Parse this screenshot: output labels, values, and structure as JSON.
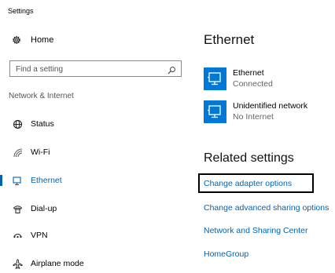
{
  "window": {
    "title": "Settings"
  },
  "sidebar": {
    "home": {
      "label": "Home",
      "icon": "gear-icon"
    },
    "search": {
      "placeholder": "Find a setting",
      "icon": "search-icon"
    },
    "section_title": "Network & Internet",
    "items": [
      {
        "label": "Status",
        "icon": "globe-icon",
        "active": false
      },
      {
        "label": "Wi-Fi",
        "icon": "wifi-icon",
        "active": false
      },
      {
        "label": "Ethernet",
        "icon": "ethernet-icon",
        "active": true
      },
      {
        "label": "Dial-up",
        "icon": "dialup-icon",
        "active": false
      },
      {
        "label": "VPN",
        "icon": "vpn-icon",
        "active": false
      },
      {
        "label": "Airplane mode",
        "icon": "airplane-icon",
        "active": false
      }
    ]
  },
  "main": {
    "title": "Ethernet",
    "networks": [
      {
        "name": "Ethernet",
        "status": "Connected",
        "icon": "monitor-network-icon"
      },
      {
        "name": "Unidentified network",
        "status": "No Internet",
        "icon": "monitor-network-icon"
      }
    ],
    "related_title": "Related settings",
    "links": [
      {
        "label": "Change adapter options",
        "highlighted": true
      },
      {
        "label": "Change advanced sharing options",
        "highlighted": false
      },
      {
        "label": "Network and Sharing Center",
        "highlighted": false
      },
      {
        "label": "HomeGroup",
        "highlighted": false
      }
    ]
  },
  "colors": {
    "accent": "#0063b1",
    "tile": "#0078d7",
    "highlight_border": "#000000"
  }
}
